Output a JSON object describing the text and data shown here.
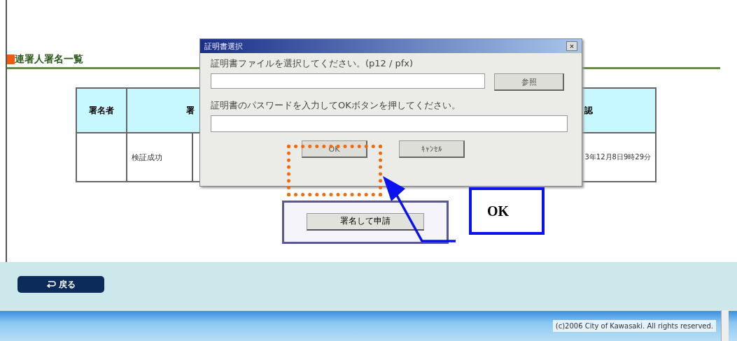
{
  "section": {
    "title": "連署人署名一覧"
  },
  "table": {
    "columns": [
      "署名者",
      "署",
      "認"
    ],
    "rows": [
      {
        "cells": [
          "",
          "検証成功",
          "",
          "3年12月8日9時29分"
        ]
      }
    ]
  },
  "submit_button": "署名して申請",
  "back_button": "戻る",
  "footer": "(c)2006 City of Kawasaki. All rights reserved.",
  "dialog": {
    "title": "証明書選択",
    "close": "×",
    "file_label": "証明書ファイルを選択してください。(p12 / pfx)",
    "browse_button": "参照",
    "password_label": "証明書のパスワードを入力してOKボタンを押してください。",
    "ok_button": "OK",
    "cancel_button": "ｷｬﾝｾﾙ"
  },
  "callout": {
    "text": "OK"
  }
}
